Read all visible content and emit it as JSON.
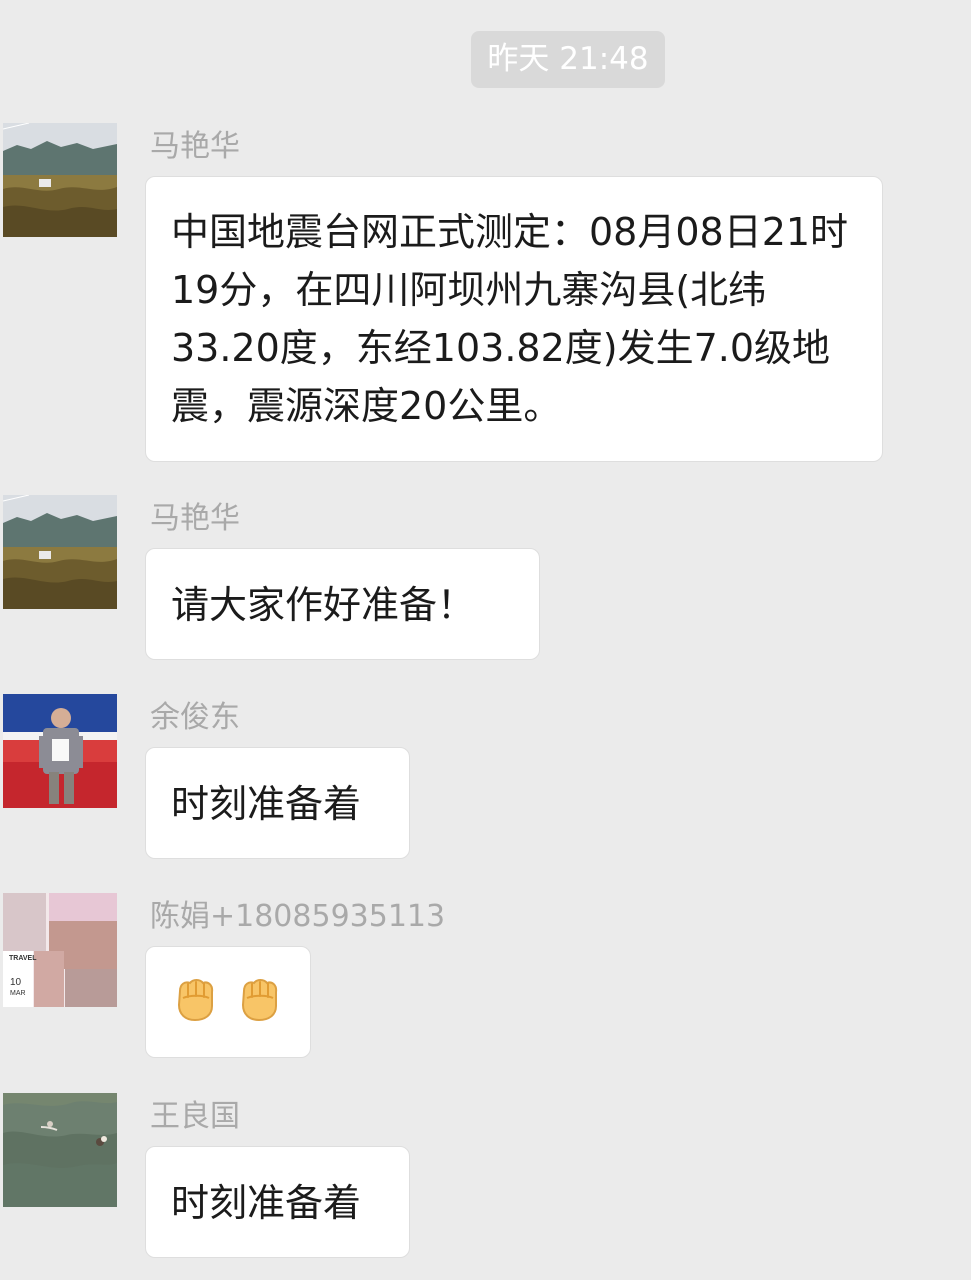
{
  "timestamp": "昨天 21:48",
  "messages": [
    {
      "sender": "马艳华",
      "text": "中国地震台网正式测定：08月08日21时19分，在四川阿坝州九寨沟县(北纬33.20度，东经103.82度)发生7.0级地震，震源深度20公里。",
      "avatar_type": "landscape"
    },
    {
      "sender": "马艳华",
      "text": "请大家作好准备！",
      "avatar_type": "landscape"
    },
    {
      "sender": "余俊东",
      "text": "时刻准备着",
      "avatar_type": "person"
    },
    {
      "sender": "陈娟+18085935113",
      "text": "",
      "emoji": [
        "fist-icon",
        "fist-icon"
      ],
      "avatar_type": "collage",
      "avatar_text": [
        "TRAVEL",
        "10",
        "MAR"
      ]
    },
    {
      "sender": "王良国",
      "text": "时刻准备着",
      "avatar_type": "water"
    }
  ],
  "colors": {
    "background": "#ebebeb",
    "bubble": "#ffffff",
    "sender": "#a9a9a9",
    "time_pill": "#d9d9d9"
  }
}
